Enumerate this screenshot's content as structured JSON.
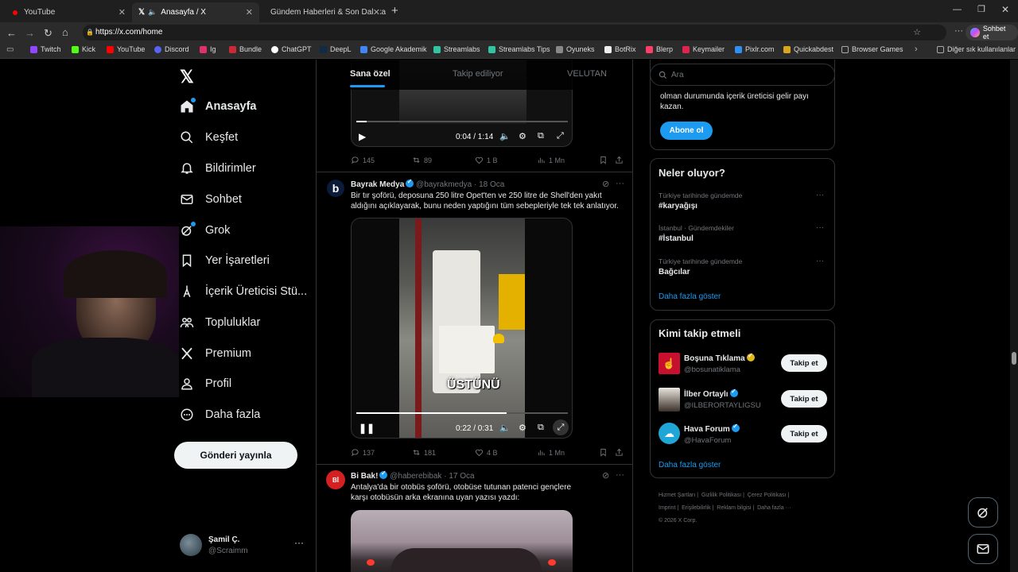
{
  "browser": {
    "tabs": [
      {
        "title": "YouTube",
        "active": false
      },
      {
        "title": "Anasayfa / X",
        "active": true
      },
      {
        "title": "Gündem Haberleri & Son Dakika H",
        "active": false
      }
    ],
    "url": "https://x.com/home",
    "chat_label": "Sohbet et",
    "bookmarks": [
      "Twitch",
      "Kick",
      "YouTube",
      "Discord",
      "Ig",
      "Bundle",
      "ChatGPT",
      "DeepL",
      "Google Akademik",
      "Streamlabs",
      "Streamlabs Tips",
      "Oyuneks",
      "BotRix",
      "Blerp",
      "Keymailer",
      "Pixlr.com",
      "Quickabdest",
      "Browser Games"
    ],
    "other_bookmarks": "Diğer sık kullanılanlar"
  },
  "nav": {
    "items": [
      {
        "label": "Anasayfa",
        "icon": "home-icon"
      },
      {
        "label": "Keşfet",
        "icon": "search-icon"
      },
      {
        "label": "Bildirimler",
        "icon": "bell-icon"
      },
      {
        "label": "Sohbet",
        "icon": "mail-icon"
      },
      {
        "label": "Grok",
        "icon": "grok-icon"
      },
      {
        "label": "Yer İşaretleri",
        "icon": "bookmark-icon"
      },
      {
        "label": "İçerik Üreticisi Stü...",
        "icon": "creator-icon"
      },
      {
        "label": "Topluluklar",
        "icon": "communities-icon"
      },
      {
        "label": "Premium",
        "icon": "x-logo-icon"
      },
      {
        "label": "Profil",
        "icon": "profile-icon"
      },
      {
        "label": "Daha fazla",
        "icon": "more-circle-icon"
      }
    ],
    "post_button": "Gönderi yayınla",
    "account": {
      "name": "Şamil Ç.",
      "handle": "@Scraimm"
    }
  },
  "timeline": {
    "tabs": [
      "Sana özel",
      "Takip ediliyor",
      "VELUTAN"
    ],
    "post1": {
      "video_time": "0:04 / 1:14",
      "progress": 0.05,
      "stats": {
        "replies": "145",
        "reposts": "89",
        "likes": "1 B",
        "views": "1 Mn"
      }
    },
    "post2": {
      "author": "Bayrak Medya",
      "handle": "@bayrakmedya",
      "date": "· 18 Oca",
      "text": "Bir tır şoförü, deposuna 250 litre Opet'ten ve 250 litre de Shell'den yakıt aldığını açıklayarak, bunu neden yaptığını tüm sebepleriyle tek tek anlatıyor.",
      "caption": "ÜSTÜNÜ",
      "video_time": "0:22 / 0:31",
      "progress": 0.71,
      "stats": {
        "replies": "137",
        "reposts": "181",
        "likes": "4 B",
        "views": "1 Mn"
      }
    },
    "post3": {
      "author": "Bi Bak!",
      "handle": "@haberebibak",
      "date": "· 17 Oca",
      "text": "Antalya'da bir otobüs şoförü, otobüse tutunan patenci gençlere karşı otobüsün arka ekranına uyan yazısı yazdı:"
    }
  },
  "sidebar": {
    "search_placeholder": "Ara",
    "premium_text": "olman durumunda içerik üreticisi gelir payı kazan.",
    "subscribe": "Abone ol",
    "trends_title": "Neler oluyor?",
    "trends": [
      {
        "context": "Türkiye tarihinde gündemde",
        "name": "#karyağışı"
      },
      {
        "context": "İstanbul · Gündemdekiler",
        "name": "#İstanbul"
      },
      {
        "context": "Türkiye tarihinde gündemde",
        "name": "Bağcılar"
      }
    ],
    "show_more": "Daha fazla göster",
    "who_title": "Kimi takip etmeli",
    "who": [
      {
        "name": "Boşuna Tıklama",
        "handle": "@bosunatiklama",
        "badge": "gold"
      },
      {
        "name": "İlber Ortaylı",
        "handle": "@ILBERORTAYLIGSU",
        "badge": "blue"
      },
      {
        "name": "Hava Forum",
        "handle": "@HavaForum",
        "badge": "blue"
      }
    ],
    "follow_label": "Takip et",
    "who_show_more": "Daha fazla göster",
    "footer": [
      "Hizmet Şartları",
      "Gizlilik Politikası",
      "Çerez Politikası",
      "Imprint",
      "Erişilebilirlik",
      "Reklam bilgisi",
      "Daha fazla ···",
      "© 2026 X Corp."
    ]
  },
  "colors": {
    "accent": "#1d9bf0",
    "bg": "#000000",
    "border": "#2f3336",
    "muted": "#71767b"
  }
}
